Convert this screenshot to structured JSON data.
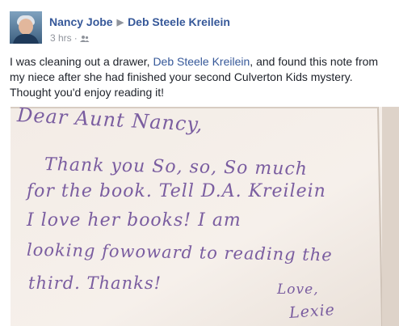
{
  "post": {
    "author": "Nancy Jobe",
    "target": "Deb Steele Kreilein",
    "time": "3 hrs",
    "separator": "·",
    "audience_icon": "friends-icon",
    "text_before": "I was cleaning out a drawer, ",
    "mention": "Deb Steele Kreilein",
    "text_after": ", and found this note from my niece after she had finished your second Culverton Kids mystery. Thought you'd enjoy reading it!"
  },
  "note": {
    "lines": [
      "Dear Aunt Nancy,",
      "Thank    you   So, so, So much",
      "for  the  book.  Tell  D.A. Kreilein",
      "I   love  her  books!  I  am",
      "looking  fowoward  to  reading  the",
      "third.  Thanks!",
      "Love,",
      "Lexie"
    ]
  },
  "colors": {
    "link": "#365899",
    "meta": "#90949c",
    "text": "#1d2129",
    "ink": "#7a5da0",
    "paper": "#f4eee9"
  }
}
